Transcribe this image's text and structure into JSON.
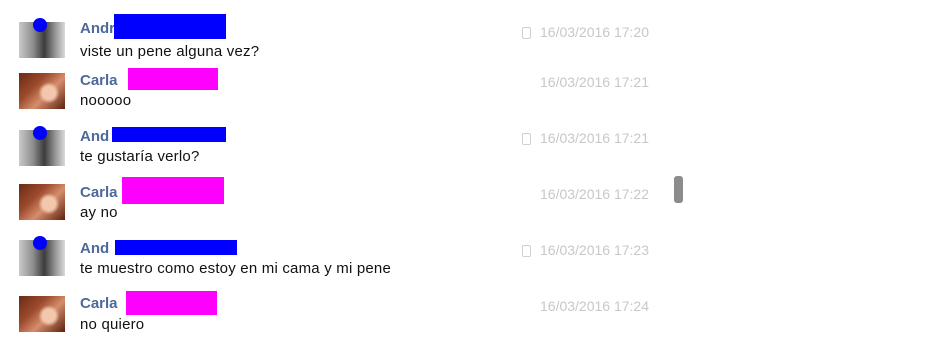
{
  "messages": [
    {
      "sender": "Andr",
      "kind": "a",
      "text": "viste un pene alguna vez?",
      "time": "16/03/2016 17:20",
      "phone": true
    },
    {
      "sender": "Carla",
      "kind": "c",
      "text": "nooooo",
      "time": "16/03/2016 17:21",
      "phone": false
    },
    {
      "sender": "And",
      "kind": "a",
      "text": "te gustaría verlo?",
      "time": "16/03/2016 17:21",
      "phone": true
    },
    {
      "sender": "Carla",
      "kind": "c",
      "text": "ay no",
      "time": "16/03/2016 17:22",
      "phone": false
    },
    {
      "sender": "And",
      "kind": "a",
      "text": "te muestro como estoy en mi cama y mi pene",
      "time": "16/03/2016 17:23",
      "phone": true
    },
    {
      "sender": "Carla",
      "kind": "c",
      "text": "no quiero",
      "time": "16/03/2016 17:24",
      "phone": false
    }
  ],
  "colors": {
    "sender_name": "#4d6a9a",
    "redaction_blue": "#0000ff",
    "redaction_pink": "#ff00ff",
    "timestamp": "#c8c8c8"
  },
  "icons": {
    "sender_a": "avatar-photo",
    "sender_c": "avatar-photo",
    "status": "mobile-phone-icon"
  }
}
